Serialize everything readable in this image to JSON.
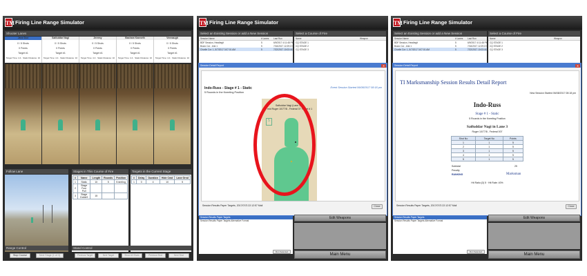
{
  "app": {
    "title": "Firing Line Range Simulator",
    "logo": "TM"
  },
  "panel1": {
    "shooter_lanes_header": "Shooter Lanes",
    "lane_columns": [
      {
        "name": "Jane Doe",
        "shots": "0 / 5 Shots",
        "points": "0 Points",
        "target": "Target #1"
      },
      {
        "name": "Saifuddar Nagi",
        "shots": "0 / 5 Shots",
        "points": "0 Points",
        "target": "Target #1"
      },
      {
        "name": "Jeremy",
        "shots": "0 / 5 Shots",
        "points": "0 Points",
        "target": "Target #1"
      },
      {
        "name": "Basham Kanneth",
        "shots": "0 / 5 Shots",
        "points": "0 Points",
        "target": "Target #1"
      },
      {
        "name": "Vennaugh",
        "shots": "0 / 5 Shots",
        "points": "0 Points",
        "target": "Target #1"
      }
    ],
    "lane_status": "Target Time: 4.4 · Static Distance: 10",
    "follow_lane_header": "Follow Lane",
    "follow_lane_caption": "Camera Following Lane",
    "stages_header": "Stages in This Course of Fire",
    "stages_columns": [
      "#",
      "Name",
      "Length",
      "Rounds",
      "Position"
    ],
    "stages_rows": [
      [
        "1",
        "Static",
        "10",
        "5",
        "Kneeling"
      ],
      [
        "2",
        "Stage Four Pull",
        "",
        "",
        ""
      ],
      [
        "3",
        "Stage Dobie9",
        "15",
        "",
        ""
      ]
    ],
    "targets_header": "Targets in the Current Stage",
    "targets_columns": [
      "#",
      "Delay",
      "Duration",
      "Hide Cmd",
      "Lane Grnd"
    ],
    "targets_rows": [
      [
        "1",
        "0",
        "4",
        "10",
        "5"
      ]
    ],
    "range_control_header": "Range Control",
    "stop_course_button": "Stop Course",
    "next_stage_button": "Next Stage (1 of 3)",
    "stand_control_header": "Stand Control",
    "stand_buttons": [
      "Previous Target",
      "Next Target",
      "Show All Shots",
      "Previous Shot",
      "Next Shot"
    ]
  },
  "panel2": {
    "select_session_header": "Select an Existing Session or add a New Session",
    "select_course_header": "Select a Course of Fire",
    "session_columns": [
      "Session Name",
      "# Lanes",
      "Last Run"
    ],
    "session_rows": [
      [
        "BDF Session, Headlegit",
        "5",
        "6/9/2017 4:11:48 PM"
      ],
      [
        "Bravo Cor - test 1",
        "5",
        "7/16/2017 12:29:19 PM"
      ],
      [
        "Charlie Cor: 1, 5/7/2017 3:07:01 AM",
        "5",
        "7/22/2017 10:03:44 PM"
      ]
    ],
    "course_columns": [
      "Name",
      "Weapon"
    ],
    "course_rows": [
      "CQ STAGE 1",
      "CQ STAGE 2",
      "CQ STAGE 3"
    ],
    "dialog_title": "Session Detail Report",
    "report_heading": "Indo-Russ - Stage # 1 - Static",
    "report_subheading": "5 Rounds in the Kneeling Position",
    "report_session_started": "Event Session Started 06/08/2017 08:18 pm",
    "target_label_line1": "Saifuddar Nagi (Lane 3)",
    "target_label_line2": "mid Ruger 10/77/8 - Federal 07 Target # 1",
    "target_number": "5",
    "footer_text": "Session Results Paper Targets, 2017/07/3 22:12:57 Mail",
    "close_button": "Close",
    "bottom_list_items": [
      "Session Results Paper Targets",
      "Session Results Paper Targets Alternative Format"
    ],
    "run_report_button": "Run Selected Report",
    "edit_weapons_button": "Edit Weapons",
    "main_menu_button": "Main Menu"
  },
  "panel3": {
    "select_session_header": "Select an Existing Session or add a New Session",
    "select_course_header": "Select a Course of Fire",
    "session_columns": [
      "Session Name",
      "# Lanes",
      "Last Run"
    ],
    "session_rows": [
      [
        "BDF Session, Headlegit",
        "5",
        "6/9/2017 4:11:48 PM"
      ],
      [
        "Bravo Cor - test 1",
        "5",
        "7/16/2017 12:29:19 PM"
      ],
      [
        "Charlie Cor: 1, 5/7/2017 3:07:01 AM",
        "5",
        "7/22/2017 10:03:44 PM"
      ]
    ],
    "course_columns": [
      "Name",
      "Weapon"
    ],
    "course_rows": [
      "CQ STAGE 1",
      "CQ STAGE 2",
      "CQ STAGE 3"
    ],
    "dialog_title": "Session Detail Report",
    "report_title": "TI Marksmanship Session Results Detail Report",
    "report_session_started": "New Session Started 06/08/2017 08:18 pm",
    "report_name": "Indo-Russ",
    "stage_line": "Stage # 1 - Static",
    "stage_sub": "5 Rounds in the Kneeling Position",
    "shooter_line": "Saifuddar Nagi in Lane 3",
    "weapon_line": "Ruger 10/77/8 - Federal 007",
    "table_columns": [
      "Shot No",
      "Target No",
      "Points"
    ],
    "table_rows": [
      [
        "1",
        "1",
        "5"
      ],
      [
        "2",
        "1",
        "5"
      ],
      [
        "3",
        "1",
        "5"
      ],
      [
        "4",
        "1",
        "5"
      ],
      [
        "5",
        "1",
        "5"
      ]
    ],
    "subtotal_label": "Subtotal",
    "subtotal_value": "25",
    "penalty_label": "Penalty",
    "ranking_label": "RANKING",
    "ranking_value": "Marksman",
    "hit_ratio": "Hit Ratio:(3) 5 · Hit Rate: 40%",
    "footer_text": "Session Results Paper Targets, 2017/07/3 22:12:57 Mail",
    "close_button": "Close",
    "bottom_list_items": [
      "Session Results Paper Targets",
      "Session Results Paper Targets Alternative Format"
    ],
    "run_report_button": "Run Selected Report",
    "edit_weapons_button": "Edit Weapons",
    "main_menu_button": "Main Menu"
  },
  "colors": {
    "brand_red": "#c0141c",
    "accent_blue": "#3a6fc4",
    "highlight_red": "#e8141c",
    "target_green": "#3fb08a"
  }
}
